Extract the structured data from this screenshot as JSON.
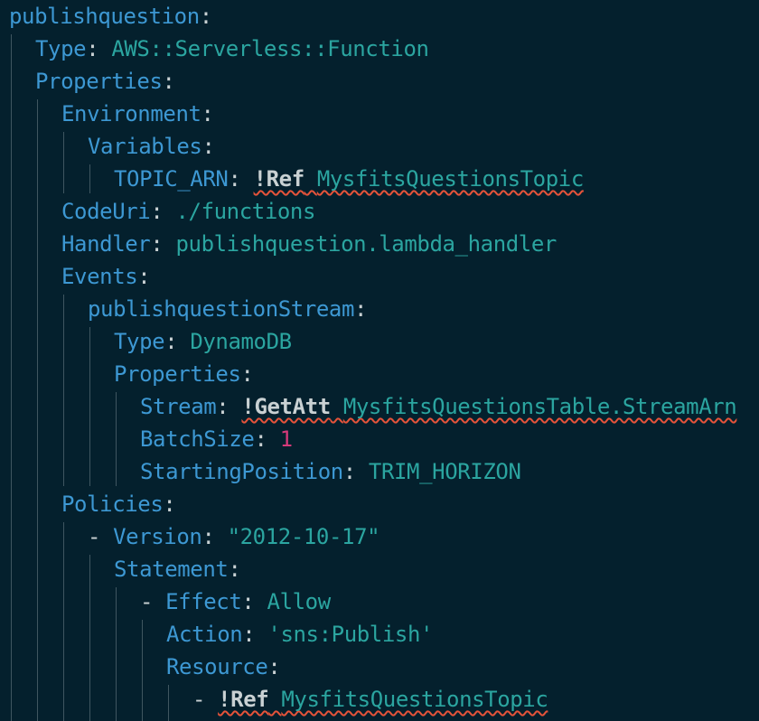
{
  "editor": {
    "lines": [
      {
        "indent": 0,
        "tokens": [
          {
            "t": "k",
            "v": "publishquestion"
          },
          {
            "t": "p",
            "v": ":"
          }
        ]
      },
      {
        "indent": 1,
        "tokens": [
          {
            "t": "k",
            "v": "Type"
          },
          {
            "t": "p",
            "v": ": "
          },
          {
            "t": "s",
            "v": "AWS::Serverless::Function"
          }
        ]
      },
      {
        "indent": 1,
        "tokens": [
          {
            "t": "k",
            "v": "Properties"
          },
          {
            "t": "p",
            "v": ":"
          }
        ]
      },
      {
        "indent": 2,
        "tokens": [
          {
            "t": "k",
            "v": "Environment"
          },
          {
            "t": "p",
            "v": ":"
          }
        ]
      },
      {
        "indent": 3,
        "tokens": [
          {
            "t": "k",
            "v": "Variables"
          },
          {
            "t": "p",
            "v": ":"
          }
        ]
      },
      {
        "indent": 4,
        "tokens": [
          {
            "t": "k",
            "v": "TOPIC_ARN"
          },
          {
            "t": "p",
            "v": ": "
          },
          {
            "t": "t",
            "v": "!Ref",
            "err": true
          },
          {
            "t": "p",
            "v": " ",
            "err": true
          },
          {
            "t": "s",
            "v": "MysfitsQuestionsTopic",
            "err": true
          }
        ]
      },
      {
        "indent": 2,
        "tokens": [
          {
            "t": "k",
            "v": "CodeUri"
          },
          {
            "t": "p",
            "v": ": "
          },
          {
            "t": "s",
            "v": "./functions"
          }
        ]
      },
      {
        "indent": 2,
        "tokens": [
          {
            "t": "k",
            "v": "Handler"
          },
          {
            "t": "p",
            "v": ": "
          },
          {
            "t": "s",
            "v": "publishquestion.lambda_handler"
          }
        ]
      },
      {
        "indent": 2,
        "tokens": [
          {
            "t": "k",
            "v": "Events"
          },
          {
            "t": "p",
            "v": ":"
          }
        ]
      },
      {
        "indent": 3,
        "tokens": [
          {
            "t": "k",
            "v": "publishquestionStream"
          },
          {
            "t": "p",
            "v": ":"
          }
        ]
      },
      {
        "indent": 4,
        "tokens": [
          {
            "t": "k",
            "v": "Type"
          },
          {
            "t": "p",
            "v": ": "
          },
          {
            "t": "s",
            "v": "DynamoDB"
          }
        ]
      },
      {
        "indent": 4,
        "tokens": [
          {
            "t": "k",
            "v": "Properties"
          },
          {
            "t": "p",
            "v": ":"
          }
        ]
      },
      {
        "indent": 5,
        "tokens": [
          {
            "t": "k",
            "v": "Stream"
          },
          {
            "t": "p",
            "v": ": "
          },
          {
            "t": "t",
            "v": "!GetAtt",
            "err": true
          },
          {
            "t": "p",
            "v": " ",
            "err": true
          },
          {
            "t": "s",
            "v": "MysfitsQuestionsTable.StreamArn",
            "err": true
          }
        ]
      },
      {
        "indent": 5,
        "tokens": [
          {
            "t": "k",
            "v": "BatchSize"
          },
          {
            "t": "p",
            "v": ": "
          },
          {
            "t": "n",
            "v": "1"
          }
        ]
      },
      {
        "indent": 5,
        "tokens": [
          {
            "t": "k",
            "v": "StartingPosition"
          },
          {
            "t": "p",
            "v": ": "
          },
          {
            "t": "s",
            "v": "TRIM_HORIZON"
          }
        ]
      },
      {
        "indent": 2,
        "tokens": [
          {
            "t": "k",
            "v": "Policies"
          },
          {
            "t": "p",
            "v": ":"
          }
        ]
      },
      {
        "indent": 3,
        "tokens": [
          {
            "t": "p",
            "v": "- "
          },
          {
            "t": "k",
            "v": "Version"
          },
          {
            "t": "p",
            "v": ": "
          },
          {
            "t": "s",
            "v": "\"2012-10-17\""
          }
        ]
      },
      {
        "indent": 4,
        "tokens": [
          {
            "t": "k",
            "v": "Statement"
          },
          {
            "t": "p",
            "v": ":"
          }
        ]
      },
      {
        "indent": 5,
        "tokens": [
          {
            "t": "p",
            "v": "- "
          },
          {
            "t": "k",
            "v": "Effect"
          },
          {
            "t": "p",
            "v": ": "
          },
          {
            "t": "s",
            "v": "Allow"
          }
        ]
      },
      {
        "indent": 6,
        "tokens": [
          {
            "t": "k",
            "v": "Action"
          },
          {
            "t": "p",
            "v": ": "
          },
          {
            "t": "s",
            "v": "'sns:Publish'"
          }
        ]
      },
      {
        "indent": 6,
        "tokens": [
          {
            "t": "k",
            "v": "Resource"
          },
          {
            "t": "p",
            "v": ":"
          }
        ]
      },
      {
        "indent": 7,
        "tokens": [
          {
            "t": "p",
            "v": "- "
          },
          {
            "t": "t",
            "v": "!Ref",
            "err": true
          },
          {
            "t": "p",
            "v": " ",
            "err": true
          },
          {
            "t": "s",
            "v": "MysfitsQuestionsTopic",
            "err": true
          }
        ]
      }
    ]
  }
}
